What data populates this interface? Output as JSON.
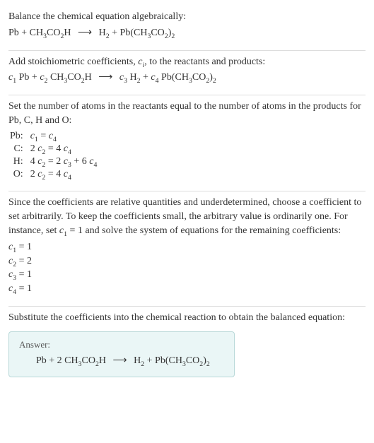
{
  "section1": {
    "intro": "Balance the chemical equation algebraically:",
    "eq_lhs1": "Pb + CH",
    "eq_lhs2": "CO",
    "eq_lhs3": "H",
    "eq_rhs1": "H",
    "eq_rhs2": " + Pb(CH",
    "eq_rhs3": "CO",
    "eq_rhs4": ")",
    "arrow": "⟶"
  },
  "section2": {
    "intro_a": "Add stoichiometric coefficients, ",
    "intro_b": ", to the reactants and products:",
    "ci": "c",
    "ci_sub": "i",
    "c1": "c",
    "c1s": "1",
    "c2": "c",
    "c2s": "2",
    "c3": "c",
    "c3s": "3",
    "c4": "c",
    "c4s": "4",
    "pb": " Pb + ",
    "ch": " CH",
    "co": "CO",
    "h_end": "H",
    "arrow": "⟶",
    "h2": " H",
    "plus": " + ",
    "pbch": " Pb(CH",
    "close": ")"
  },
  "section3": {
    "intro": "Set the number of atoms in the reactants equal to the number of atoms in the products for Pb, C, H and O:",
    "rows": [
      {
        "label": "Pb:",
        "eq_a": "c",
        "eq_as": "1",
        "eq_mid": " = ",
        "eq_b": "c",
        "eq_bs": "4",
        "pre": "",
        "mid2": "",
        "c": "",
        "cs": "",
        "post": ""
      },
      {
        "label": "C:",
        "eq_a": "c",
        "eq_as": "2",
        "eq_mid": " = 4 ",
        "eq_b": "c",
        "eq_bs": "4",
        "pre": "2 ",
        "mid2": "",
        "c": "",
        "cs": "",
        "post": ""
      },
      {
        "label": "H:",
        "eq_a": "c",
        "eq_as": "2",
        "eq_mid": " = 2 ",
        "eq_b": "c",
        "eq_bs": "3",
        "pre": "4 ",
        "mid2": " + 6 ",
        "c": "c",
        "cs": "4",
        "post": ""
      },
      {
        "label": "O:",
        "eq_a": "c",
        "eq_as": "2",
        "eq_mid": " = 4 ",
        "eq_b": "c",
        "eq_bs": "4",
        "pre": "2 ",
        "mid2": "",
        "c": "",
        "cs": "",
        "post": ""
      }
    ]
  },
  "section4": {
    "intro": "Since the coefficients are relative quantities and underdetermined, choose a coefficient to set arbitrarily. To keep the coefficients small, the arbitrary value is ordinarily one. For instance, set ",
    "c1": "c",
    "c1s": "1",
    "intro2": " = 1 and solve the system of equations for the remaining coefficients:",
    "lines": [
      {
        "c": "c",
        "s": "1",
        "v": " = 1"
      },
      {
        "c": "c",
        "s": "2",
        "v": " = 2"
      },
      {
        "c": "c",
        "s": "3",
        "v": " = 1"
      },
      {
        "c": "c",
        "s": "4",
        "v": " = 1"
      }
    ]
  },
  "section5": {
    "intro": "Substitute the coefficients into the chemical reaction to obtain the balanced equation:",
    "answer_label": "Answer:",
    "eq": {
      "a": "Pb + 2 CH",
      "b": "CO",
      "c": "H",
      "arrow": "⟶",
      "d": "H",
      "e": " + Pb(CH",
      "f": "CO",
      "g": ")"
    }
  },
  "subs": {
    "n2": "2",
    "n3": "3"
  }
}
